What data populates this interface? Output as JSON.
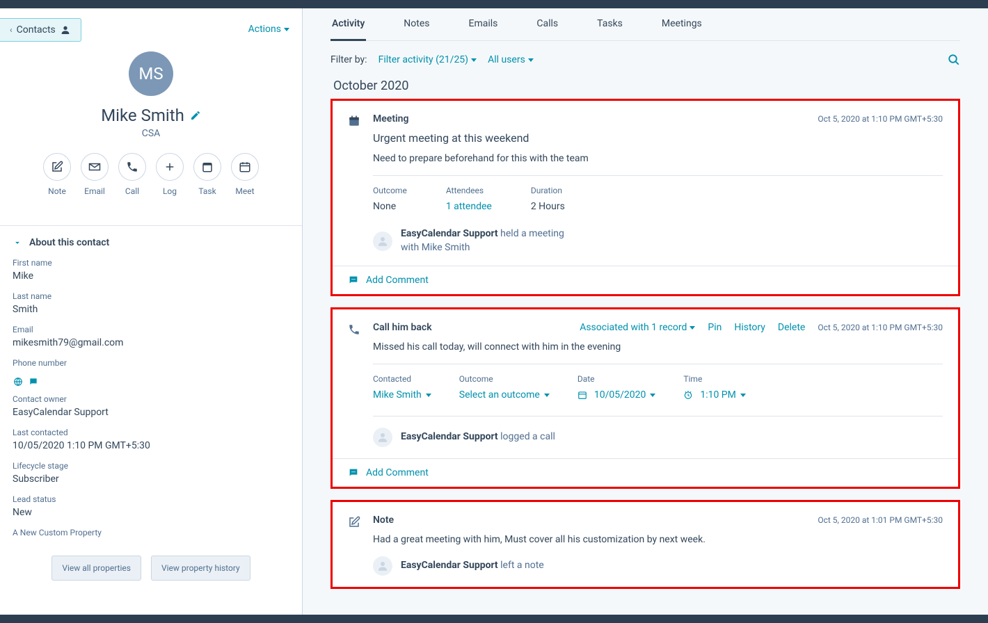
{
  "back_label": "Contacts",
  "actions_label": "Actions",
  "avatar_initials": "MS",
  "contact_name": "Mike Smith",
  "contact_subtitle": "CSA",
  "quick_actions": {
    "note": "Note",
    "email": "Email",
    "call": "Call",
    "log": "Log",
    "task": "Task",
    "meet": "Meet"
  },
  "about_section": "About this contact",
  "fields": {
    "first_name_label": "First name",
    "first_name": "Mike",
    "last_name_label": "Last name",
    "last_name": "Smith",
    "email_label": "Email",
    "email": "mikesmith79@gmail.com",
    "phone_label": "Phone number",
    "phone": "",
    "owner_label": "Contact owner",
    "owner": "EasyCalendar Support",
    "last_contacted_label": "Last contacted",
    "last_contacted": "10/05/2020 1:10 PM GMT+5:30",
    "lifecycle_label": "Lifecycle stage",
    "lifecycle": "Subscriber",
    "lead_label": "Lead status",
    "lead": "New",
    "custom_label": "A New Custom Property"
  },
  "view_all": "View all properties",
  "view_history": "View property history",
  "tabs": {
    "activity": "Activity",
    "notes": "Notes",
    "emails": "Emails",
    "calls": "Calls",
    "tasks": "Tasks",
    "meetings": "Meetings"
  },
  "filter": {
    "label": "Filter by:",
    "activity": "Filter activity (21/25)",
    "users": "All users"
  },
  "month": "October 2020",
  "add_comment": "Add Comment",
  "meeting": {
    "type": "Meeting",
    "time": "Oct 5, 2020 at 1:10 PM GMT+5:30",
    "title": "Urgent meeting at this weekend",
    "desc": "Need to prepare beforehand for this with the team",
    "outcome_label": "Outcome",
    "outcome": "None",
    "attendees_label": "Attendees",
    "attendees": "1 attendee",
    "duration_label": "Duration",
    "duration": "2 Hours",
    "user": "EasyCalendar Support",
    "action": "held a meeting",
    "with": "with Mike Smith"
  },
  "call": {
    "type": "Call him back",
    "time": "Oct 5, 2020 at 1:10 PM GMT+5:30",
    "associated": "Associated with 1 record",
    "pin": "Pin",
    "history": "History",
    "delete": "Delete",
    "desc": "Missed his call today, will connect with him in the evening",
    "contacted_label": "Contacted",
    "contacted": "Mike Smith",
    "outcome_label": "Outcome",
    "outcome": "Select an outcome",
    "date_label": "Date",
    "date": "10/05/2020",
    "time_label": "Time",
    "time_val": "1:10 PM",
    "user": "EasyCalendar Support",
    "action": "logged a call"
  },
  "note": {
    "type": "Note",
    "time": "Oct 5, 2020 at 1:01 PM GMT+5:30",
    "desc": "Had a great meeting with him, Must cover all his customization by next week.",
    "user": "EasyCalendar Support",
    "action": "left a note"
  }
}
